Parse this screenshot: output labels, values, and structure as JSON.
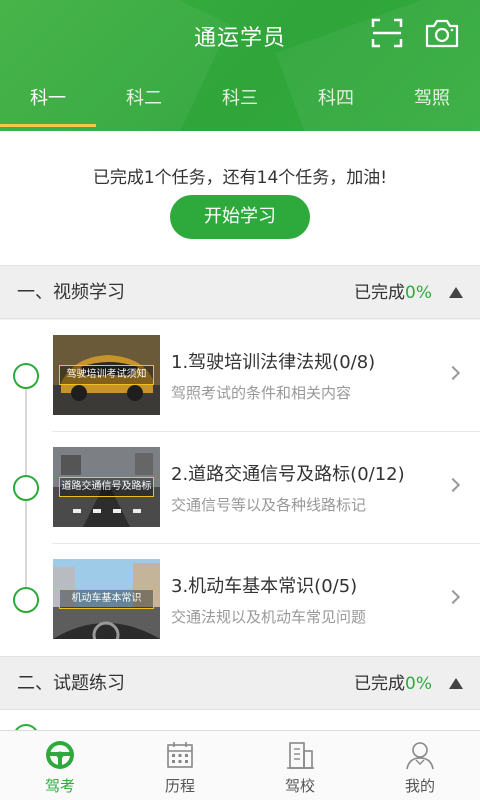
{
  "header": {
    "title": "通运学员"
  },
  "tabs": [
    {
      "label": "科一"
    },
    {
      "label": "科二"
    },
    {
      "label": "科三"
    },
    {
      "label": "科四"
    },
    {
      "label": "驾照"
    }
  ],
  "progress": {
    "text": "已完成1个任务，还有14个任务，加油!",
    "start_button": "开始学习"
  },
  "sections": [
    {
      "title": "一、视频学习",
      "status_label": "已完成",
      "status_pct": "0%"
    },
    {
      "title": "二、试题练习",
      "status_label": "已完成",
      "status_pct": "0%"
    }
  ],
  "videos": [
    {
      "thumb_label": "驾驶培训考试须知",
      "title": "1.驾驶培训法律法规(0/8)",
      "desc": "驾照考试的条件和相关内容"
    },
    {
      "thumb_label": "道路交通信号及路标",
      "title": "2.道路交通信号及路标(0/12)",
      "desc": "交通信号等以及各种线路标记"
    },
    {
      "thumb_label": "机动车基本常识",
      "title": "3.机动车基本常识(0/5)",
      "desc": "交通法规以及机动车常见问题"
    }
  ],
  "bottom_nav": [
    {
      "label": "驾考",
      "icon": "steering-wheel-icon"
    },
    {
      "label": "历程",
      "icon": "calendar-icon"
    },
    {
      "label": "驾校",
      "icon": "building-icon"
    },
    {
      "label": "我的",
      "icon": "person-icon"
    }
  ],
  "colors": {
    "brand_green": "#2eaa3c",
    "tab_indicator": "#f3c94a"
  }
}
